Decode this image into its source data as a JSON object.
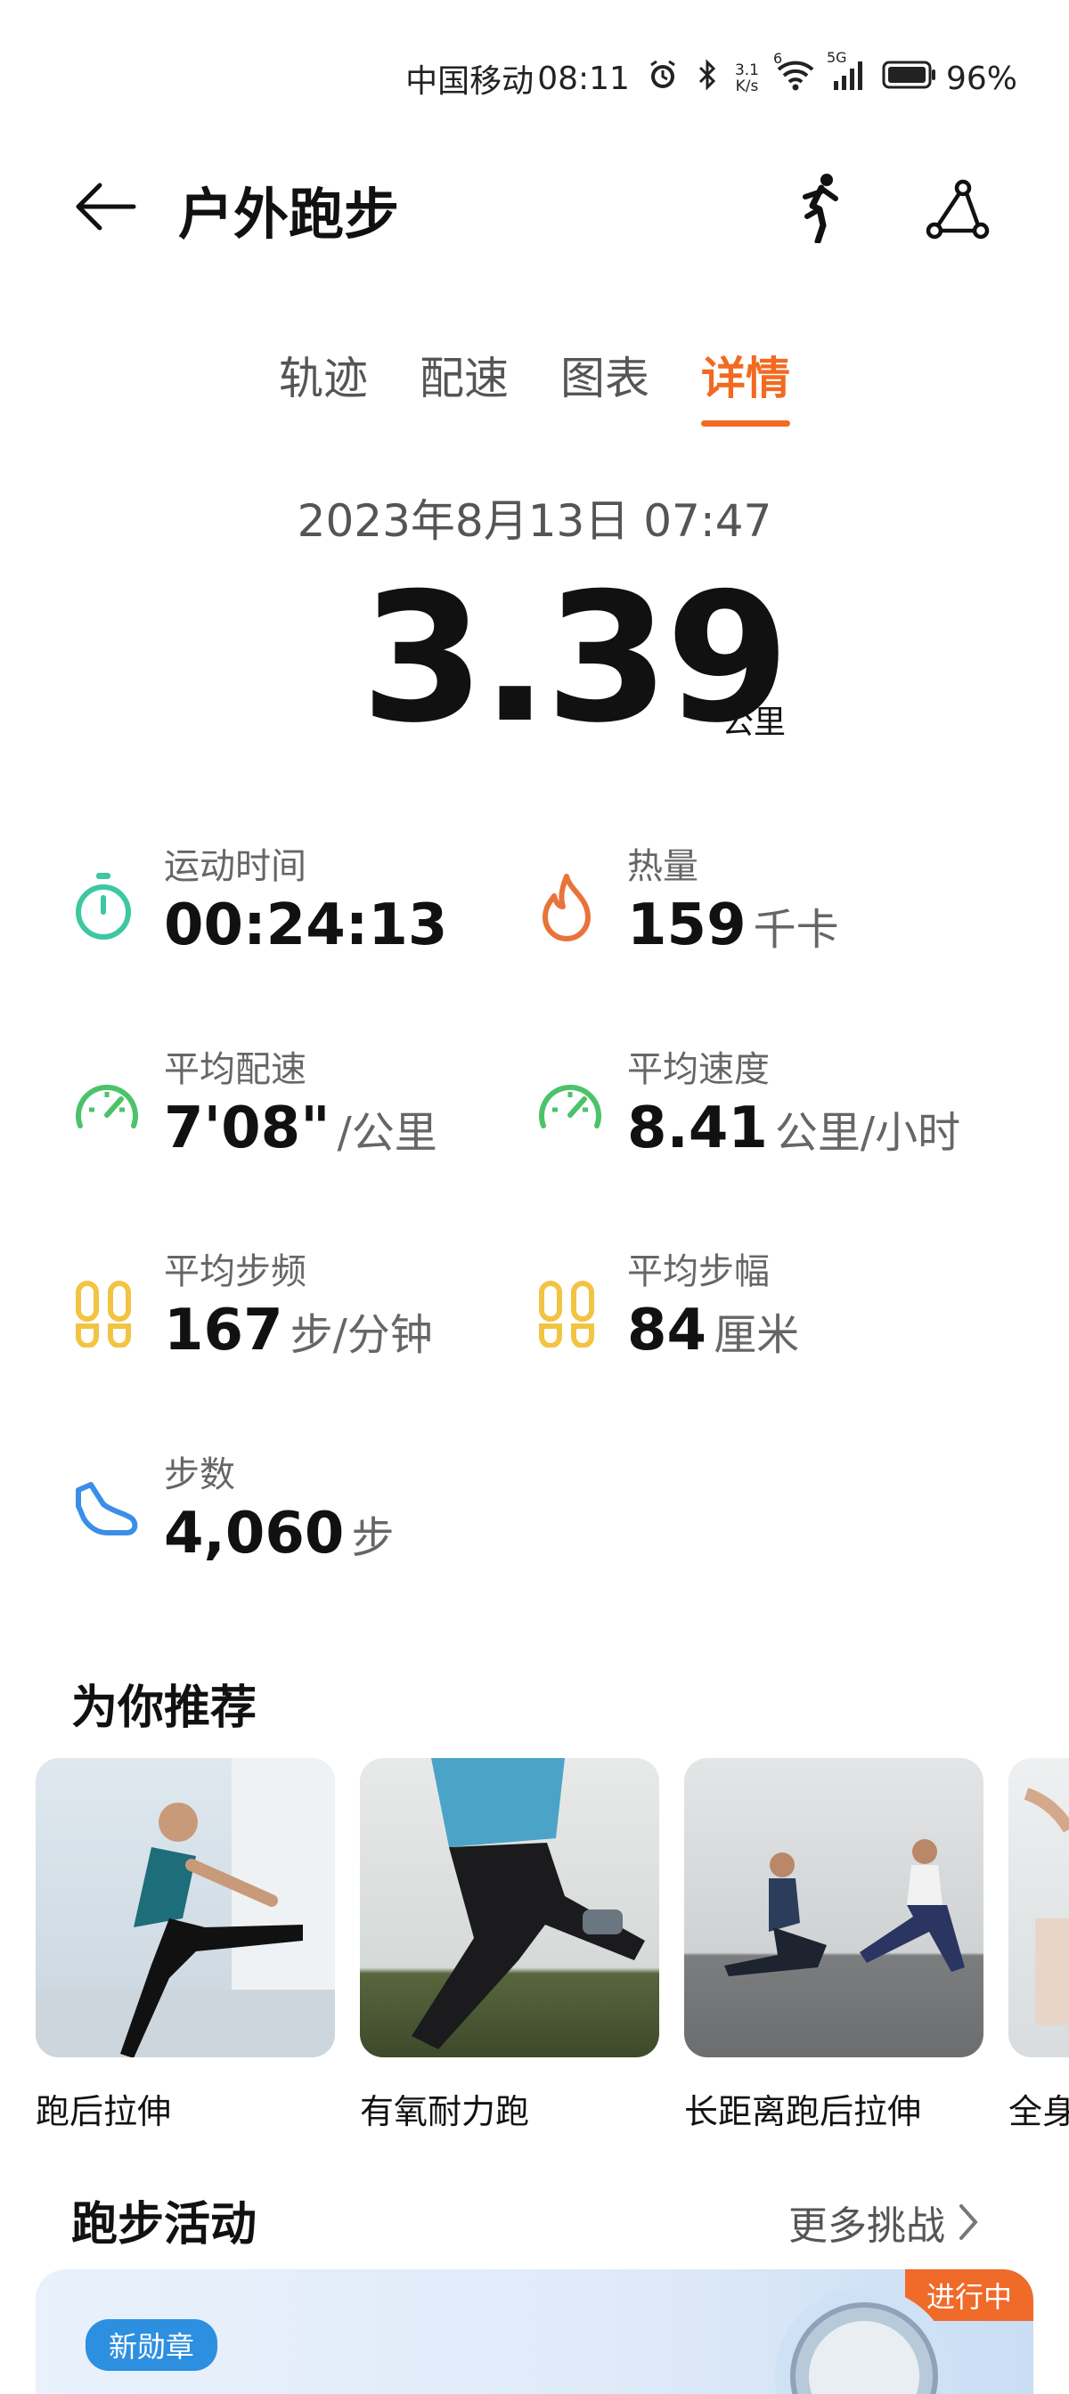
{
  "status_bar": {
    "carrier": "中国移动",
    "time": "08:11",
    "net_speed_value": "3.1",
    "net_speed_unit": "K/s",
    "wifi_badge": "6",
    "cell_badge": "5G",
    "battery": "96%"
  },
  "header": {
    "title": "户外跑步"
  },
  "tabs": [
    {
      "label": "轨迹",
      "active": false
    },
    {
      "label": "配速",
      "active": false
    },
    {
      "label": "图表",
      "active": false
    },
    {
      "label": "详情",
      "active": true
    }
  ],
  "summary": {
    "datetime": "2023年8月13日 07:47",
    "distance": "3.39",
    "distance_unit": "公里"
  },
  "metrics": [
    {
      "label": "运动时间",
      "value": "00:24:13",
      "unit": "",
      "icon": "stopwatch-icon",
      "color": "#3cc8a0"
    },
    {
      "label": "热量",
      "value": "159",
      "unit": "千卡",
      "icon": "flame-icon",
      "color": "#e8743b"
    },
    {
      "label": "平均配速",
      "value": "7'08\"",
      "unit": "/公里",
      "icon": "gauge-icon",
      "color": "#4cc36a"
    },
    {
      "label": "平均速度",
      "value": "8.41",
      "unit": "公里/小时",
      "icon": "gauge-icon",
      "color": "#4cc36a"
    },
    {
      "label": "平均步频",
      "value": "167",
      "unit": "步/分钟",
      "icon": "footprints-icon",
      "color": "#f2c443"
    },
    {
      "label": "平均步幅",
      "value": "84",
      "unit": "厘米",
      "icon": "footprints-icon",
      "color": "#f2c443"
    },
    {
      "label": "步数",
      "value": "4,060",
      "unit": "步",
      "icon": "shoe-icon",
      "color": "#3b8ee8"
    }
  ],
  "recommend": {
    "title": "为你推荐",
    "items": [
      {
        "label": "跑后拉伸"
      },
      {
        "label": "有氧耐力跑"
      },
      {
        "label": "长距离跑后拉伸"
      },
      {
        "label": "全身"
      }
    ]
  },
  "activities": {
    "title": "跑步活动",
    "more": "更多挑战",
    "badge": "新勋章",
    "status": "进行中"
  }
}
